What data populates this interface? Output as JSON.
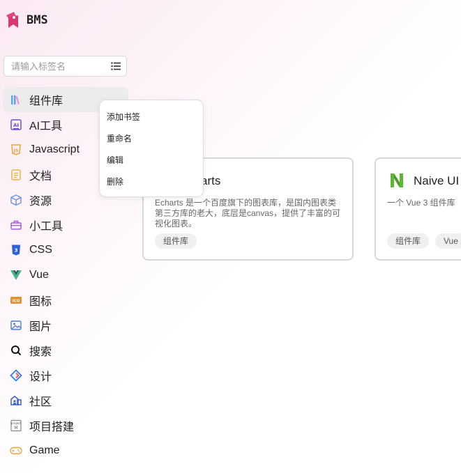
{
  "app": {
    "name": "BMS"
  },
  "search": {
    "placeholder": "请输入标签名",
    "value": ""
  },
  "sidebar": {
    "items": [
      {
        "label": "组件库",
        "icon": "books-icon",
        "active": true
      },
      {
        "label": "AI工具",
        "icon": "ai-icon"
      },
      {
        "label": "Javascript",
        "icon": "js-icon"
      },
      {
        "label": "文档",
        "icon": "document-icon"
      },
      {
        "label": "资源",
        "icon": "cube-icon"
      },
      {
        "label": "小工具",
        "icon": "toolbox-icon"
      },
      {
        "label": "CSS",
        "icon": "css-icon"
      },
      {
        "label": "Vue",
        "icon": "vue-icon"
      },
      {
        "label": "图标",
        "icon": "ico-icon"
      },
      {
        "label": "图片",
        "icon": "image-icon"
      },
      {
        "label": "搜索",
        "icon": "search-icon"
      },
      {
        "label": "设计",
        "icon": "design-icon"
      },
      {
        "label": "社区",
        "icon": "community-icon"
      },
      {
        "label": "项目搭建",
        "icon": "project-icon"
      },
      {
        "label": "Game",
        "icon": "gamepad-icon"
      }
    ]
  },
  "context_menu": {
    "items": [
      "添加书签",
      "重命名",
      "编辑",
      "删除"
    ]
  },
  "cards": [
    {
      "title": "Echarts",
      "title_visible": "arts",
      "desc": "Echarts 是一个百度旗下的图表库，是国内图表类第三方库的老大，底层是canvas，提供了丰富的可视化图表。",
      "tags": [
        "组件库"
      ]
    },
    {
      "title": "Naive UI",
      "desc": "一个 Vue 3 组件库",
      "tags": [
        "组件库",
        "Vue"
      ]
    }
  ],
  "colors": {
    "accent": "#e8447a",
    "naive": "#5fb832",
    "vue_green": "#41b883",
    "vue_dark": "#35495e"
  }
}
